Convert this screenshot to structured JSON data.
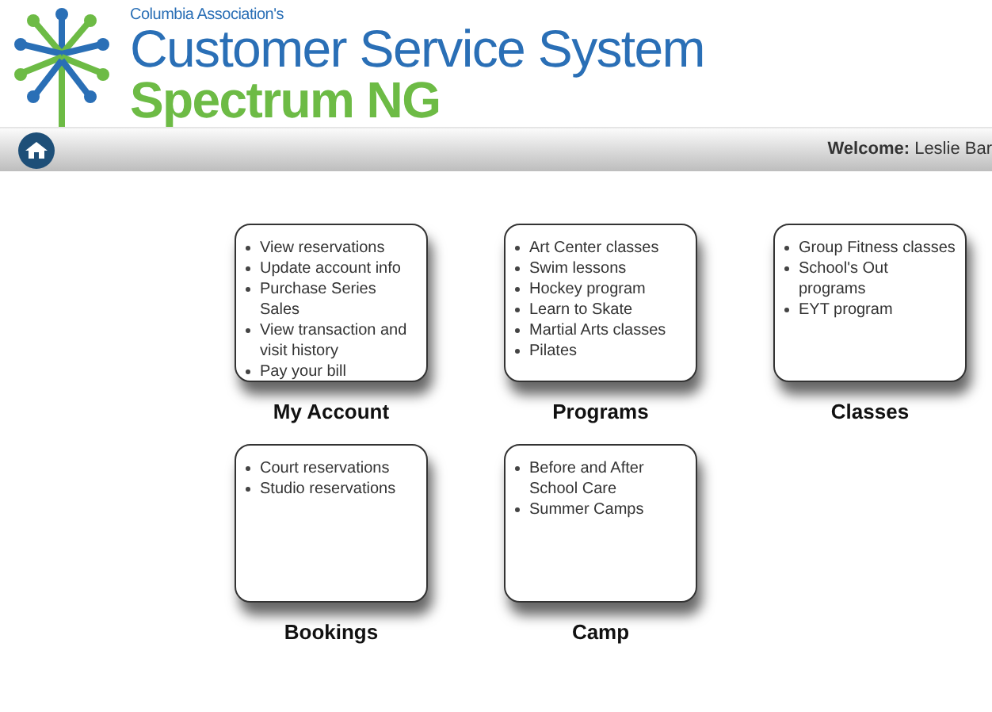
{
  "header": {
    "organization": "Columbia Association's",
    "title": "Customer Service System",
    "product": "Spectrum NG"
  },
  "nav_bar": {
    "welcome": "**Welcome:** Leslie Bar"
  },
  "tiles": [
    {
      "title": "My Account",
      "items": [
        "View reservations",
        "Update account info",
        "Purchase Series Sales",
        "View transaction and visit history",
        "Pay your bill"
      ]
    },
    {
      "title": "Programs",
      "items": [
        "Art Center classes",
        "Swim lessons",
        "Hockey program",
        "Learn to Skate",
        "Martial Arts classes",
        "Pilates"
      ]
    },
    {
      "title": "Classes",
      "items": [
        "Group Fitness classes",
        "School's Out programs",
        "EYT program"
      ]
    },
    {
      "title": "Bookings",
      "items": [
        "Court reservations",
        "Studio reservations"
      ]
    },
    {
      "title": "Camp",
      "items": [
        "Before and After School Care",
        "Summer Camps"
      ]
    }
  ]
}
